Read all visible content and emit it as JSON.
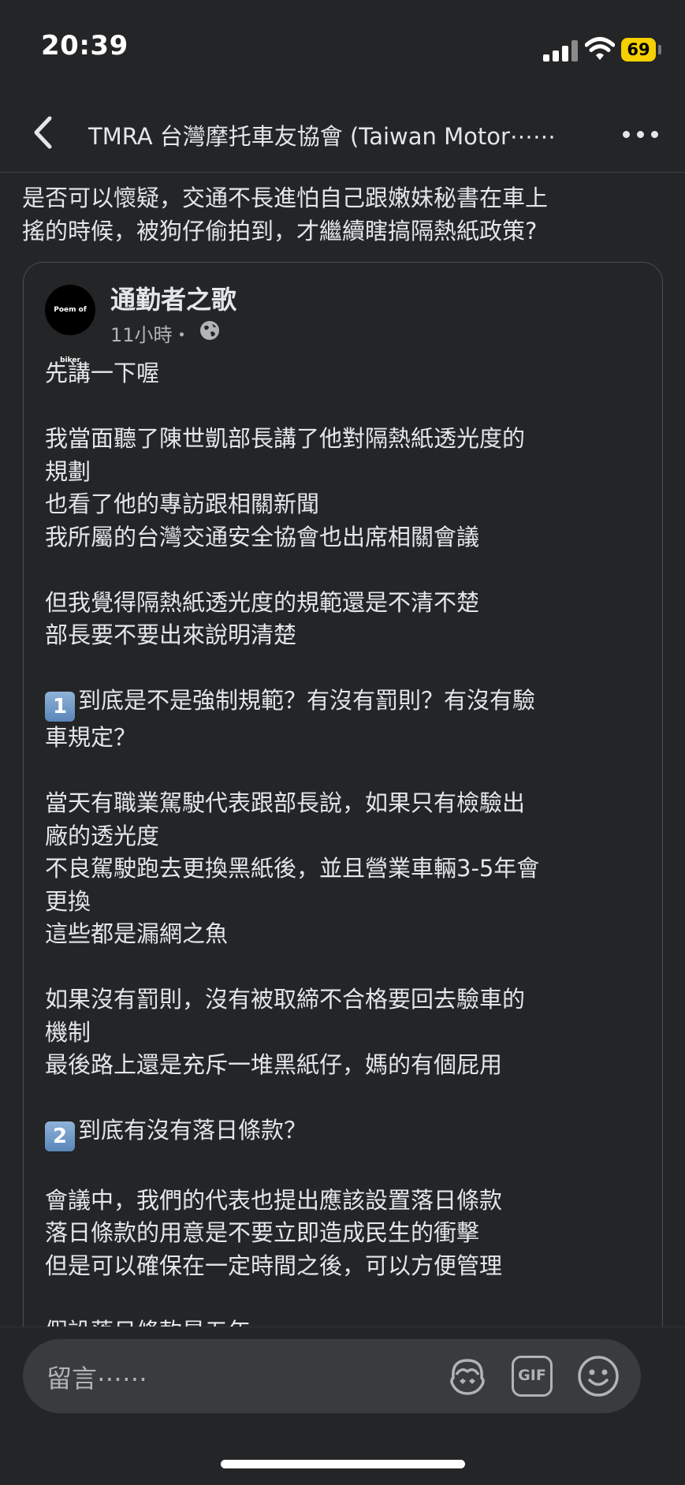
{
  "status_bar": {
    "time": "20:39",
    "battery": "69"
  },
  "header": {
    "title": "TMRA 台灣摩托車友協會 (Taiwan Motor⋯⋯"
  },
  "post": {
    "text_lines": [
      "是否可以懷疑，交通不長進怕自己跟嫩妹秘書在車上",
      "搖的時候，被狗仔偷拍到，才繼續瞎搞隔熱紙政策?"
    ]
  },
  "shared_post": {
    "avatar_text": "Poem of biker",
    "author": "通勤者之歌",
    "time": "11小時・",
    "lines": [
      "先講一下喔",
      "",
      "我當面聽了陳世凱部長講了他對隔熱紙透光度的",
      "規劃",
      "也看了他的專訪跟相關新聞",
      "我所屬的台灣交通安全協會也出席相關會議",
      "",
      "但我覺得隔熱紙透光度的規範還是不清不楚",
      "部長要不要出來說明清楚",
      "",
      "到底是不是強制規範？有沒有罰則？有沒有驗",
      "車規定？",
      "",
      "當天有職業駕駛代表跟部長說，如果只有檢驗出",
      "廠的透光度",
      "不良駕駛跑去更換黑紙後，並且營業車輛3-5年會",
      "更換",
      "這些都是漏網之魚",
      "",
      "如果沒有罰則，沒有被取締不合格要回去驗車的",
      "機制",
      "最後路上還是充斥一堆黑紙仔，媽的有個屁用",
      "",
      "到底有沒有落日條款？",
      "",
      "會議中，我們的代表也提出應該設置落日條款",
      "落日條款的用意是不要立即造成民生的衝擊",
      "但是可以確保在一定時間之後，可以方便管理",
      "",
      "假設落日條款是五年"
    ],
    "keycap_1": "1",
    "keycap_2": "2"
  },
  "comment_bar": {
    "placeholder": "留言⋯⋯",
    "gif_label": "GIF"
  }
}
